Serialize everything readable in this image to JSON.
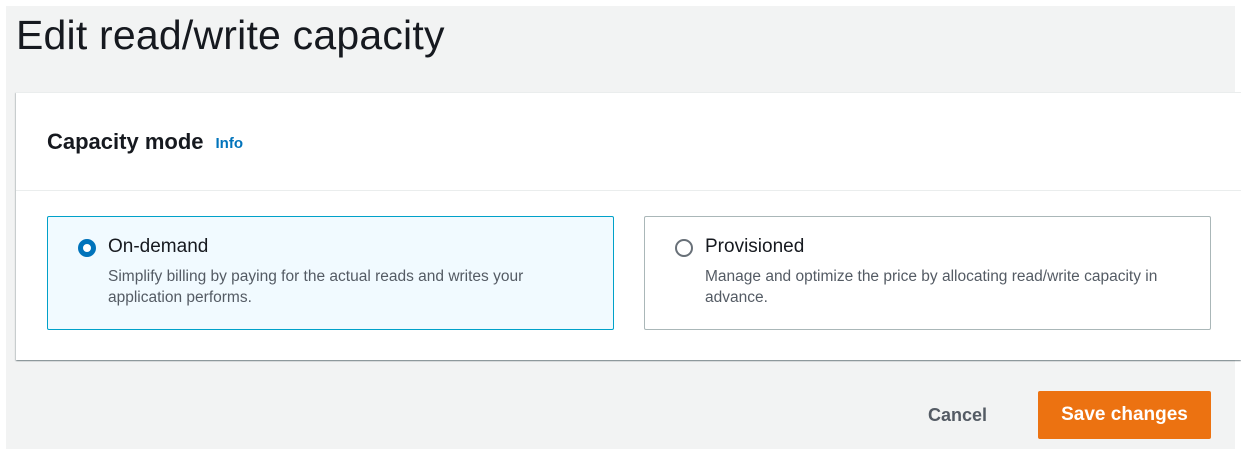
{
  "page": {
    "title": "Edit read/write capacity"
  },
  "capacity_section": {
    "title": "Capacity mode",
    "info_link": "Info",
    "selected": "On-demand",
    "options": [
      {
        "label": "On-demand",
        "description": "Simplify billing by paying for the actual reads and writes your application performs.",
        "selected": true
      },
      {
        "label": "Provisioned",
        "description": "Manage and optimize the price by allocating read/write capacity in advance.",
        "selected": false
      }
    ]
  },
  "actions": {
    "cancel_label": "Cancel",
    "save_label": "Save changes"
  },
  "colors": {
    "accent_blue": "#0073bb",
    "selected_border": "#00a1c9",
    "selected_bg": "#f1faff",
    "primary_button": "#ec7211",
    "page_bg": "#f2f3f3"
  }
}
